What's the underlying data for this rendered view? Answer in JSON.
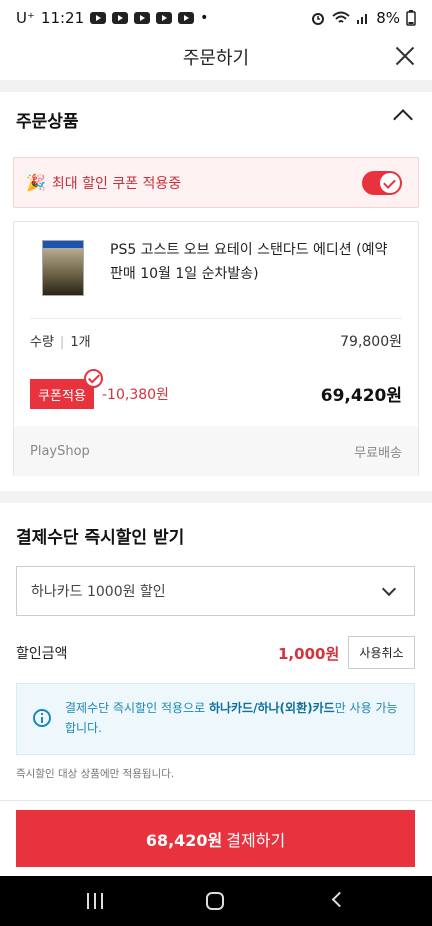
{
  "status_bar": {
    "carrier": "U⁺",
    "time": "11:21",
    "dot": "•",
    "battery": "8%"
  },
  "header": {
    "title": "주문하기"
  },
  "order_section": {
    "title": "주문상품",
    "coupon_banner": {
      "party": "🎉",
      "text": "최대 할인 쿠폰 적용중",
      "toggle_on": true
    },
    "product": {
      "name": "PS5 고스트 오브 요테이 스탠다드 에디션 (예약판매 10월 1일 순차발송)",
      "qty_label": "수량",
      "qty_value": "1개",
      "unit_price": "79,800원",
      "coupon_button": "쿠폰적용",
      "discount": "-10,380원",
      "final_price": "69,420원",
      "seller": "PlayShop",
      "shipping": "무료배송"
    }
  },
  "payment_section": {
    "title": "결제수단 즉시할인 받기",
    "selected_option": "하나카드 1000원 할인",
    "discount_label": "할인금액",
    "discount_amount": "1,000원",
    "cancel_button": "사용취소",
    "info": {
      "prefix": "결제수단 즉시할인 적용으로 ",
      "highlight": "하나카드/하나(외환)카드",
      "suffix": "만 사용 가능합니다."
    },
    "note": "즉시할인 대상 상품에만 적용됩니다."
  },
  "pay_button": {
    "amount": "68,420원",
    "label": "결제하기"
  },
  "colors": {
    "accent": "#e8333e",
    "info": "#1b87b8"
  }
}
